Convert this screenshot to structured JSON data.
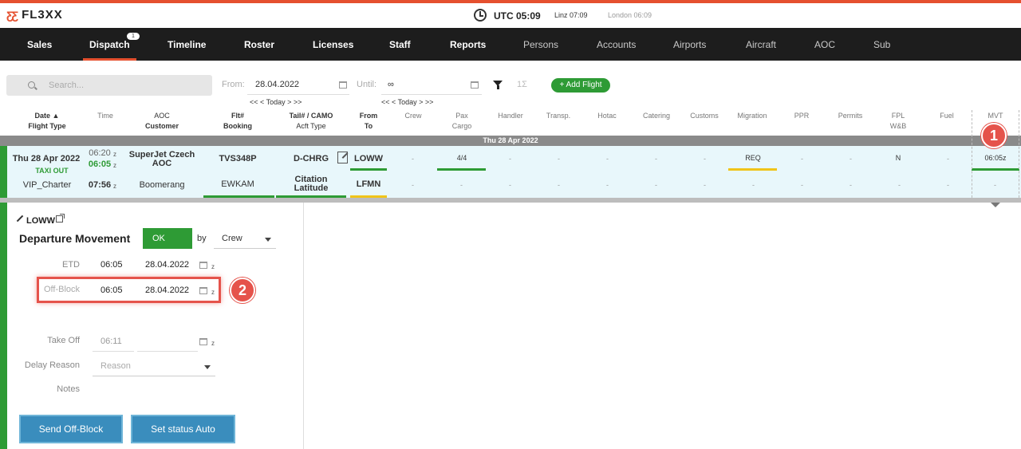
{
  "app": {
    "logo_mark": "ƸƸ",
    "logo_text": "FL3XX"
  },
  "clock": {
    "utc": "UTC 05:09",
    "linz": "Linz 07:09",
    "london": "London 06:09"
  },
  "nav": {
    "items": [
      {
        "label": "Sales"
      },
      {
        "label": "Dispatch",
        "badge": "1"
      },
      {
        "label": "Timeline"
      },
      {
        "label": "Roster"
      },
      {
        "label": "Licenses"
      },
      {
        "label": "Staff"
      },
      {
        "label": "Reports"
      },
      {
        "label": "Persons"
      },
      {
        "label": "Accounts"
      },
      {
        "label": "Airports"
      },
      {
        "label": "Aircraft"
      },
      {
        "label": "AOC"
      },
      {
        "label": "Sub"
      }
    ]
  },
  "filters": {
    "search_placeholder": "Search...",
    "from_label": "From:",
    "from_value": "28.04.2022",
    "until_label": "Until:",
    "until_value": "∞",
    "today_nav": "<< < Today > >>",
    "sigma": "1Σ",
    "add_flight": "+ Add Flight"
  },
  "columns": {
    "date": "Date ▲",
    "flight_type": "Flight Type",
    "time": "Time",
    "aoc": "AOC",
    "customer": "Customer",
    "flt": "Flt#",
    "booking": "Booking",
    "tail": "Tail# / CAMO",
    "acft_type": "Acft Type",
    "from": "From",
    "to": "To",
    "crew": "Crew",
    "pax": "Pax",
    "cargo": "Cargo",
    "handler": "Handler",
    "transp": "Transp.",
    "hotac": "Hotac",
    "catering": "Catering",
    "customs": "Customs",
    "migration": "Migration",
    "ppr": "PPR",
    "permits": "Permits",
    "fpl": "FPL",
    "wb": "W&B",
    "fuel": "Fuel",
    "mvt": "MVT"
  },
  "date_band": "Thu 28 Apr 2022",
  "flight": {
    "date": "Thu 28 Apr 2022",
    "status": "TAXI OUT",
    "flight_type": "VIP_Charter",
    "time_sched": "06:20",
    "time_actual": "06:05",
    "time_arr": "07:56",
    "z": "z",
    "aoc": "SuperJet Czech AOC",
    "customer": "Boomerang",
    "flt": "TVS348P",
    "booking": "EWKAM",
    "tail": "D-CHRG",
    "acft_type": "Citation Latitude",
    "from": "LOWW",
    "to": "LFMN",
    "pax": "4/4",
    "migration": "REQ",
    "fpl": "N",
    "mvt": "06:05z",
    "dash": "-"
  },
  "markers": {
    "one": "1",
    "two": "2"
  },
  "movement": {
    "airport": "LOWW",
    "title": "Departure Movement",
    "status": "OK",
    "by_label": "by",
    "by_value": "Crew",
    "etd_label": "ETD",
    "etd_time": "06:05",
    "etd_date": "28.04.2022",
    "offblock_label": "Off-Block",
    "offblock_time": "06:05",
    "offblock_date": "28.04.2022",
    "takeoff_label": "Take Off",
    "takeoff_time": "06:11",
    "delay_label": "Delay Reason",
    "delay_placeholder": "Reason",
    "notes_label": "Notes",
    "z": "z",
    "send_button": "Send Off-Block",
    "auto_button": "Set status Auto"
  },
  "colors": {
    "accent": "#e5502f",
    "green": "#2e9b35",
    "button": "#3a8dbd",
    "marker": "#e5534b"
  }
}
